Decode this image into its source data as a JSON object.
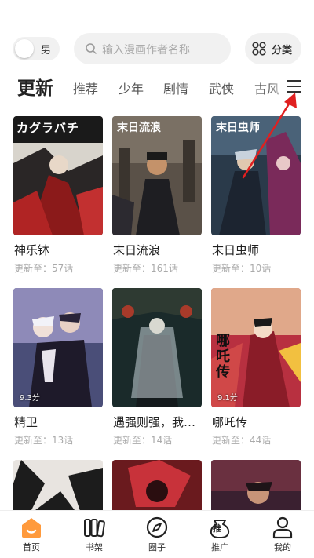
{
  "header": {
    "gender_label": "男",
    "search_placeholder": "输入漫画作者名称",
    "category_label": "分类"
  },
  "tabs": [
    {
      "label": "更新",
      "active": true
    },
    {
      "label": "推荐"
    },
    {
      "label": "少年"
    },
    {
      "label": "剧情"
    },
    {
      "label": "武侠"
    },
    {
      "label": "古风"
    }
  ],
  "comics": [
    {
      "title": "神乐钵",
      "update": "更新至：57话",
      "rating": ""
    },
    {
      "title": "末日流浪",
      "update": "更新至：161话",
      "rating": ""
    },
    {
      "title": "末日虫师",
      "update": "更新至：10话",
      "rating": ""
    },
    {
      "title": "精卫",
      "update": "更新至：13话",
      "rating": "9.3分"
    },
    {
      "title": "遇强则强，我…",
      "update": "更新至：14话",
      "rating": ""
    },
    {
      "title": "哪吒传",
      "update": "更新至：44话",
      "rating": "9.1分"
    },
    {
      "title": "",
      "update": "",
      "rating": ""
    },
    {
      "title": "",
      "update": "",
      "rating": ""
    },
    {
      "title": "",
      "update": "",
      "rating": ""
    }
  ],
  "cover_texts": {
    "c1": "カグラバチ",
    "c2": "末日流浪",
    "c3": "末日虫师",
    "c6": "哪吒传"
  },
  "bottom_nav": [
    {
      "label": "首页",
      "icon": "home-icon",
      "active": true
    },
    {
      "label": "书架",
      "icon": "bookshelf-icon"
    },
    {
      "label": "圈子",
      "icon": "compass-icon"
    },
    {
      "label": "推广",
      "icon": "promote-icon",
      "badge": "推"
    },
    {
      "label": "我的",
      "icon": "profile-icon"
    }
  ],
  "colors": {
    "accent": "#ff9a3c",
    "annotation": "#e02020"
  }
}
